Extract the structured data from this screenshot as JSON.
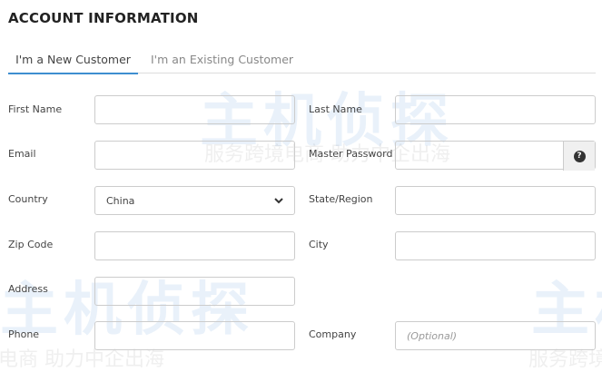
{
  "watermark": {
    "logo": "主机侦探",
    "slogan": "服务跨境电商 助力中企出海"
  },
  "title": "ACCOUNT INFORMATION",
  "tabs": [
    {
      "label": "I'm a New Customer",
      "active": true
    },
    {
      "label": "I'm an Existing Customer",
      "active": false
    }
  ],
  "fields": {
    "first_name": {
      "label": "First Name",
      "value": ""
    },
    "last_name": {
      "label": "Last Name",
      "value": ""
    },
    "email": {
      "label": "Email",
      "value": ""
    },
    "master_password": {
      "label": "Master Password",
      "value": "",
      "help_icon": "?"
    },
    "country": {
      "label": "Country",
      "value": "China"
    },
    "state": {
      "label": "State/Region",
      "value": ""
    },
    "zip": {
      "label": "Zip Code",
      "value": ""
    },
    "city": {
      "label": "City",
      "value": ""
    },
    "address": {
      "label": "Address",
      "value": ""
    },
    "phone": {
      "label": "Phone",
      "value": ""
    },
    "company": {
      "label": "Company",
      "placeholder": "(Optional)"
    }
  },
  "colors": {
    "accent": "#3e8ed0"
  }
}
